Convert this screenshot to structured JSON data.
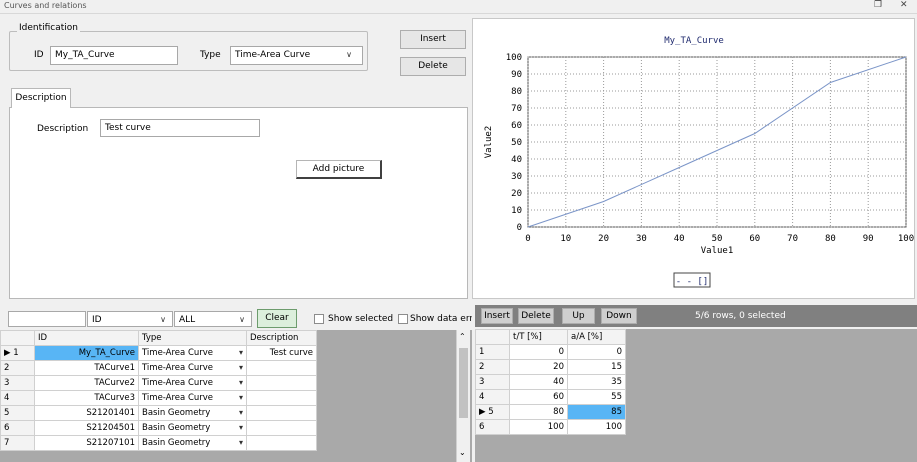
{
  "window": {
    "title": "Curves and relations",
    "restore_glyph": "❐",
    "close_glyph": "✕"
  },
  "identification": {
    "legend": "Identification",
    "id_label": "ID",
    "id_value": "My_TA_Curve",
    "type_label": "Type",
    "type_value": "Time-Area Curve",
    "insert_label": "Insert",
    "delete_label": "Delete"
  },
  "description_tab": {
    "tab_label": "Description",
    "desc_label": "Description",
    "desc_value": "Test curve",
    "add_picture_label": "Add picture"
  },
  "chart_data": {
    "type": "line",
    "title": "My_TA_Curve",
    "xlabel": "Value1",
    "ylabel": "Value2",
    "x": [
      0,
      20,
      40,
      60,
      80,
      100
    ],
    "series": [
      {
        "values": [
          0,
          15,
          35,
          55,
          85,
          100
        ]
      }
    ],
    "xlim": [
      0,
      100
    ],
    "ylim": [
      0,
      100
    ],
    "xticks": [
      "0",
      "10",
      "20",
      "30",
      "40",
      "50",
      "60",
      "70",
      "80",
      "90",
      "100"
    ],
    "yticks": [
      "100",
      "90",
      "80",
      "70",
      "60",
      "50",
      "40",
      "30",
      "20",
      "10",
      "0"
    ],
    "grid": true,
    "legend_text": "- - []",
    "legend_position": "bottom-center",
    "line_color": "#7b95c8"
  },
  "filter_bar": {
    "search_value": "",
    "field_value": "ID",
    "scope_value": "ALL",
    "clear_label": "Clear",
    "show_selected_label": "Show selected",
    "show_errors_label": "Show data erro"
  },
  "curves_table": {
    "headers": [
      "",
      "ID",
      "Type",
      "Description"
    ],
    "rows": [
      {
        "num": "1",
        "id": "My_TA_Curve",
        "type": "Time-Area Curve",
        "desc": "Test curve",
        "current": true
      },
      {
        "num": "2",
        "id": "TACurve1",
        "type": "Time-Area Curve",
        "desc": ""
      },
      {
        "num": "3",
        "id": "TACurve2",
        "type": "Time-Area Curve",
        "desc": ""
      },
      {
        "num": "4",
        "id": "TACurve3",
        "type": "Time-Area Curve",
        "desc": ""
      },
      {
        "num": "5",
        "id": "S21201401",
        "type": "Basin Geometry",
        "desc": ""
      },
      {
        "num": "6",
        "id": "S21204501",
        "type": "Basin Geometry",
        "desc": ""
      },
      {
        "num": "7",
        "id": "S21207101",
        "type": "Basin Geometry",
        "desc": ""
      }
    ]
  },
  "values_toolbar": {
    "insert_label": "Insert",
    "delete_label": "Delete",
    "up_label": "Up",
    "down_label": "Down",
    "status": "5/6 rows, 0 selected"
  },
  "values_table": {
    "headers": [
      "",
      "t/T [%]",
      "a/A [%]"
    ],
    "rows": [
      {
        "num": "1",
        "t": "0",
        "a": "0"
      },
      {
        "num": "2",
        "t": "20",
        "a": "15"
      },
      {
        "num": "3",
        "t": "40",
        "a": "35"
      },
      {
        "num": "4",
        "t": "60",
        "a": "55"
      },
      {
        "num": "5",
        "t": "80",
        "a": "85",
        "current": true
      },
      {
        "num": "6",
        "t": "100",
        "a": "100"
      }
    ]
  },
  "colors": {
    "selection": "#58b5f5",
    "toolbar_bg": "#808080",
    "status_text": "#ffffff"
  }
}
